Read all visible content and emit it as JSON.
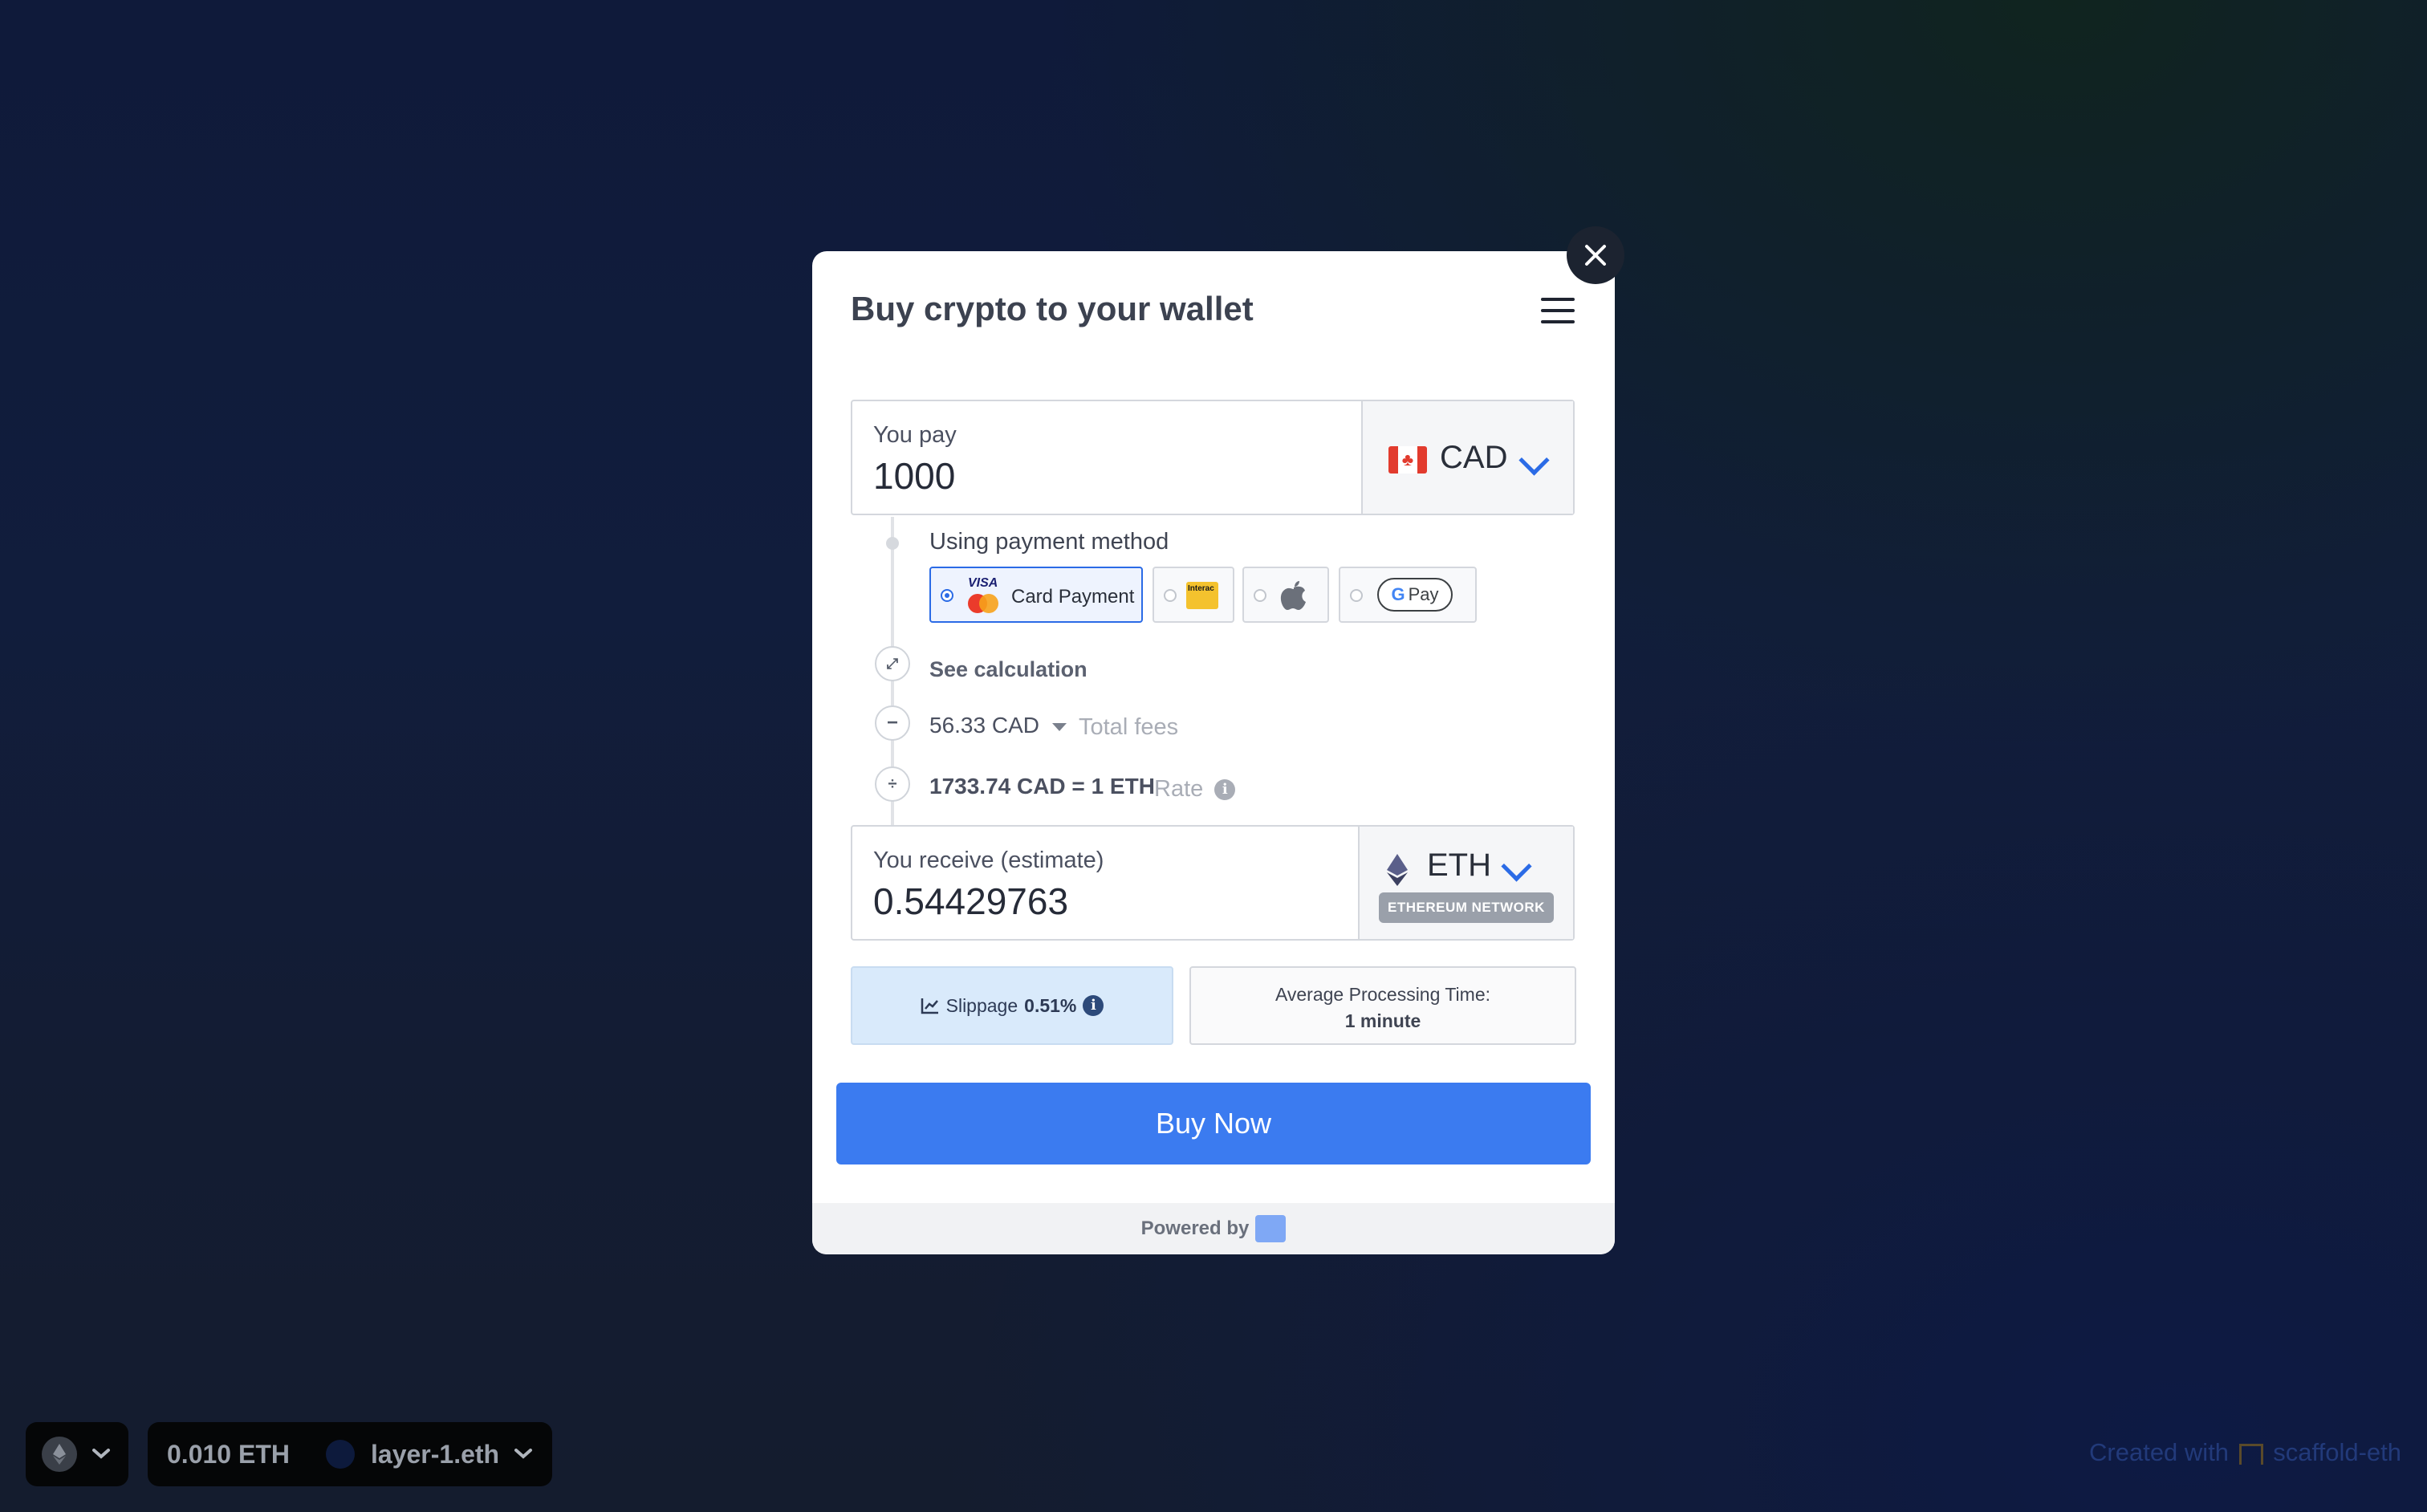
{
  "modal": {
    "title": "Buy crypto to your wallet",
    "pay": {
      "label": "You pay",
      "amount": "1000",
      "currency": "CAD",
      "flag_icon": "canada-flag-icon"
    },
    "payment_method": {
      "label": "Using payment method",
      "options": [
        {
          "name": "card",
          "label": "Card Payment",
          "brand_text": "VISA",
          "selected": true
        },
        {
          "name": "interac",
          "brand_text": "Interac",
          "selected": false
        },
        {
          "name": "apple-pay",
          "icon": "apple-icon",
          "selected": false
        },
        {
          "name": "google-pay",
          "brand_text": "Pay",
          "selected": false
        }
      ]
    },
    "calculation": {
      "toggle_label": "See calculation",
      "fees_value": "56.33 CAD",
      "fees_label": "Total fees",
      "rate_value": "1733.74 CAD = 1 ETH",
      "rate_label": "Rate"
    },
    "receive": {
      "label": "You receive (estimate)",
      "amount": "0.54429763",
      "currency": "ETH",
      "network": "ETHEREUM NETWORK"
    },
    "slippage": {
      "label": "Slippage",
      "value": "0.51%"
    },
    "processing": {
      "label": "Average Processing Time:",
      "value": "1 minute"
    },
    "buy_button": "Buy Now",
    "footer": "Powered by"
  },
  "bottom_bar": {
    "balance": "0.010 ETH",
    "account": "layer-1.eth",
    "created_prefix": "Created with",
    "created_brand": "scaffold-eth"
  },
  "colors": {
    "accent": "#3b7bf0",
    "slippage_bg": "#d9eafb",
    "close_bg": "#1c2330"
  }
}
